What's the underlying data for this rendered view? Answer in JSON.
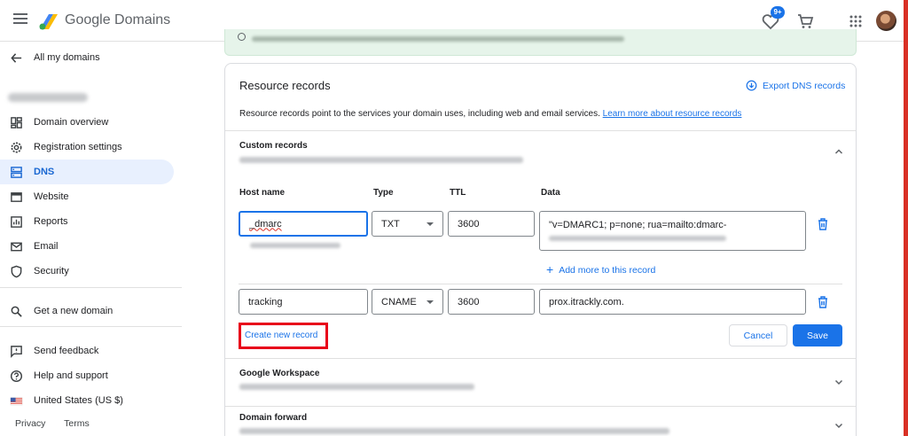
{
  "app": {
    "title_google": "Google",
    "title_product": "Domains"
  },
  "header": {
    "notification_count": "9+"
  },
  "sidebar": {
    "back_label": "All my domains",
    "items": [
      {
        "label": "Domain overview",
        "icon": "dashboard-icon"
      },
      {
        "label": "Registration settings",
        "icon": "gear-icon"
      },
      {
        "label": "DNS",
        "icon": "dns-icon",
        "active": true
      },
      {
        "label": "Website",
        "icon": "website-icon"
      },
      {
        "label": "Reports",
        "icon": "reports-icon"
      },
      {
        "label": "Email",
        "icon": "email-icon"
      },
      {
        "label": "Security",
        "icon": "shield-icon"
      }
    ],
    "get_new_domain": "Get a new domain",
    "send_feedback": "Send feedback",
    "help_support": "Help and support",
    "region": "United States (US $)",
    "footer": {
      "privacy": "Privacy",
      "terms": "Terms"
    }
  },
  "resource_records": {
    "title": "Resource records",
    "export_label": "Export DNS records",
    "description": "Resource records point to the services your domain uses, including web and email services.",
    "learn_more": "Learn more about resource records"
  },
  "custom_records": {
    "title": "Custom records",
    "columns": {
      "host": "Host name",
      "type": "Type",
      "ttl": "TTL",
      "data": "Data"
    },
    "rows": [
      {
        "host": "_dmarc",
        "type": "TXT",
        "ttl": "3600",
        "data": "\"v=DMARC1; p=none; rua=mailto:dmarc-"
      },
      {
        "host": "tracking",
        "type": "CNAME",
        "ttl": "3600",
        "data": "prox.itrackly.com."
      }
    ],
    "add_more": "Add more to this record",
    "create_new": "Create new record",
    "cancel": "Cancel",
    "save": "Save"
  },
  "sections": {
    "workspace": "Google Workspace",
    "domain_forward": "Domain forward"
  }
}
